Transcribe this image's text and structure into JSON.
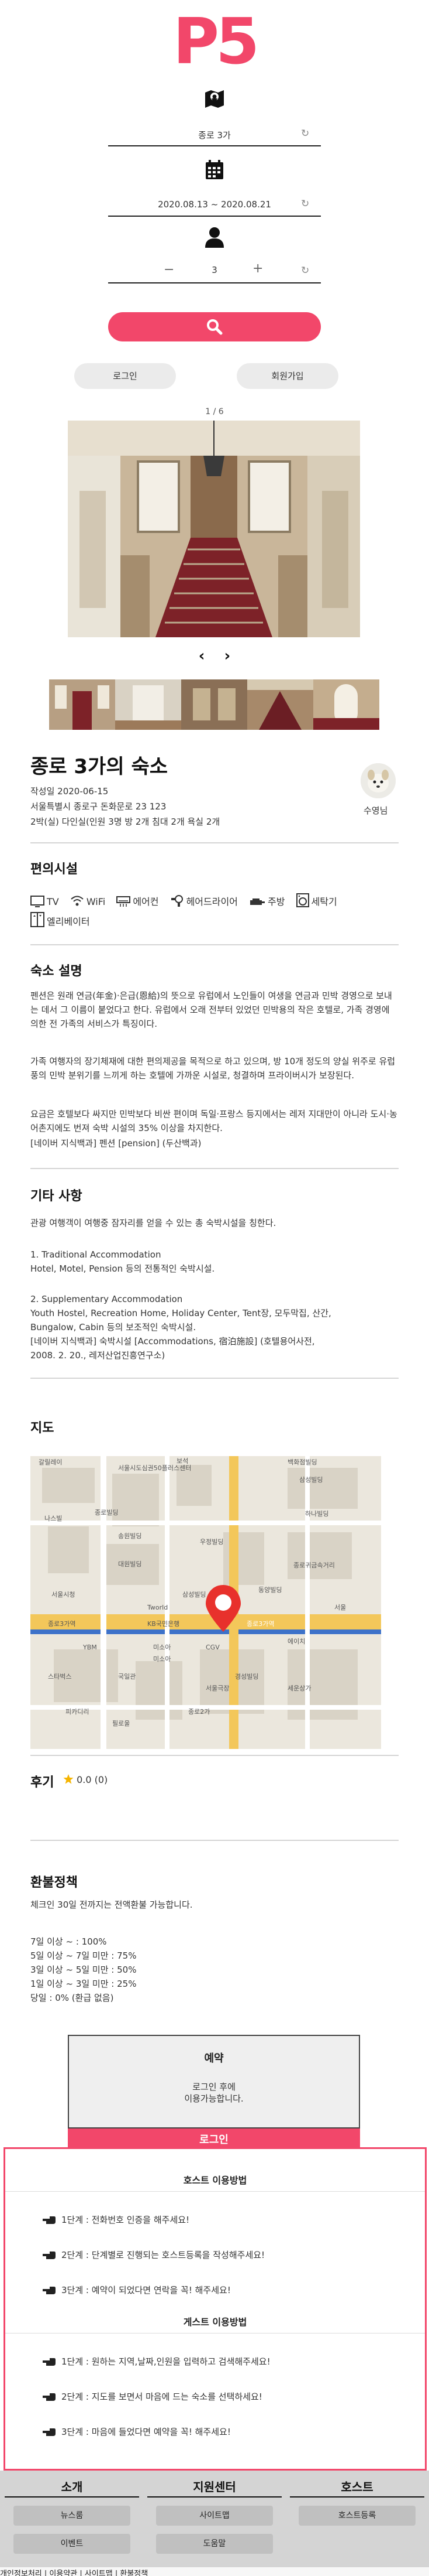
{
  "logo": {
    "text": "P5"
  },
  "search": {
    "location": "종로 3가",
    "dates": "2020.08.13 ~ 2020.08.21",
    "guests": "3",
    "minus": "−",
    "plus": "+"
  },
  "auth": {
    "login": "로그인",
    "signup": "회원가입"
  },
  "gallery": {
    "counter": "1 / 6",
    "prev": "‹",
    "next": "›"
  },
  "listing": {
    "title": "종로 3가의 숙소",
    "date": "작성일 2020-06-15",
    "address": "서울특별시 종로구 돈화문로 23 123",
    "summary": "2박(실) 다인실(인원 3명 방 2개 침대 2개 욕실 2개",
    "host": "수영님"
  },
  "amenities": {
    "title": "편의시설",
    "items": [
      {
        "icon": "tv-icon",
        "label": "TV"
      },
      {
        "icon": "wifi-icon",
        "label": "WiFi"
      },
      {
        "icon": "aircon-icon",
        "label": "에어컨"
      },
      {
        "icon": "hairdryer-icon",
        "label": "헤어드라이어"
      },
      {
        "icon": "kitchen-icon",
        "label": "주방"
      },
      {
        "icon": "washer-icon",
        "label": "세탁기"
      },
      {
        "icon": "elevator-icon",
        "label": "엘리베이터"
      }
    ]
  },
  "description": {
    "title": "숙소 설명",
    "p1": "펜션은 원래 연금(年金)·은급(恩給)의 뜻으로 유럽에서 노인들이 여생을 연금과 민박 경영으로 보내는 데서 그 이름이 붙었다고 한다. 유럽에서 오래 전부터 있었던 민박용의 작은 호텔로, 가족 경영에 의한 전 가족의 서비스가 특징이다.",
    "p2": "가족 여행자의 장기체재에 대한 편의제공을 목적으로 하고 있으며, 방 10개 정도의 양실 위주로 유럽풍의 민박 분위기를 느끼게 하는 호텔에 가까운 시설로, 청결하며 프라이버시가 보장된다.",
    "p3": "요금은 호텔보다 싸지만 민박보다 비싼 편이며 독일·프랑스 등지에서는 레저 지대만이 아니라 도시·농어촌지에도 번져 숙박 시설의 35% 이상을 차지한다.",
    "p3b": "[네이버 지식백과] 펜션 [pension] (두산백과)"
  },
  "other": {
    "title": "기타 사항",
    "p1": "관광 여행객이 여행중 잠자리를 얻을 수 있는 총 숙박시설을 칭한다.",
    "l1": "1. Traditional Accommodation",
    "l2": "Hotel, Motel, Pension 등의 전통적인 숙박시설.",
    "l3": "2. Supplementary Accommodation",
    "l4": "Youth Hostel, Recreation Home, Holiday Center, Tent장, 모두막집, 산간,",
    "l5": "Bungalow, Cabin 등의 보조적인 숙박시설.",
    "l6": "[네이버 지식백과] 숙박시설 [Accommodations, 宿泊施設] (호텔용어사전,",
    "l7": "2008. 2. 20., 레저산업진흥연구소)"
  },
  "map": {
    "title": "지도",
    "labels": [
      "갈릴레이",
      "서울시도심권50플러스센터",
      "보석",
      "백화점빌딩",
      "삼성빌딩",
      "나스빌",
      "종로빌딩",
      "하나빌딩",
      "서울시청",
      "송원빌딩",
      "대원빌딩",
      "우정빌딩",
      "종로귀금속거리",
      "삼성빌딩",
      "KB국민은행",
      "종로3가역",
      "종로3가역",
      "Tworld",
      "서울",
      "동양빌딩",
      "미소아",
      "경성빌딩",
      "YBM",
      "미소아",
      "CGV",
      "스타벅스",
      "국일관",
      "서울극장",
      "에이치",
      "필로울",
      "피카디리",
      "세운상가",
      "종로2가"
    ]
  },
  "reviews": {
    "title": "후기",
    "score": "0.0 (0)"
  },
  "refund": {
    "title": "환불정책",
    "intro": "체크인 30일 전까지는 전액환불 가능합니다.",
    "r1": "7일 이상 ~ : 100%",
    "r2": "5일 이상 ~ 7일 미만 : 75%",
    "r3": "3일 이상 ~ 5일 미만 : 50%",
    "r4": "1일 이상 ~ 3일 미만 : 25%",
    "r5": "당일 : 0% (환급 없음)"
  },
  "reserve": {
    "title": "예약",
    "line1": "로그인 후에",
    "line2": "이용가능합니다.",
    "login": "로그인"
  },
  "guide": {
    "host_title": "호스트 이용방법",
    "host_steps": [
      "1단계 : 전화번호 인증을 해주세요!",
      "2단계 : 단계별로 진행되는 호스트등록을 작성해주세요!",
      "3단계 : 예약이 되었다면 연락을 꼭! 해주세요!"
    ],
    "guest_title": "게스트 이용방법",
    "guest_steps": [
      "1단계 : 원하는 지역,날짜,인원을 입력하고 검색해주세요!",
      "2단계 : 지도를 보면서 마음에 드는 숙소를 선택하세요!",
      "3단계 : 마음에 들었다면 예약을 꼭! 해주세요!"
    ]
  },
  "footer": {
    "col1": "소개",
    "col2": "지원센터",
    "col3": "호스트",
    "news": "뉴스룸",
    "sitemap": "사이트맵",
    "host_register": "호스트등록",
    "event": "이벤트",
    "help": "도움말",
    "bottom": "개인정보처리 | 이용약관 | 사이트맵 | 환불정책"
  },
  "colors": {
    "accent": "#f2476a",
    "footer_bg": "#d4d4d4"
  }
}
